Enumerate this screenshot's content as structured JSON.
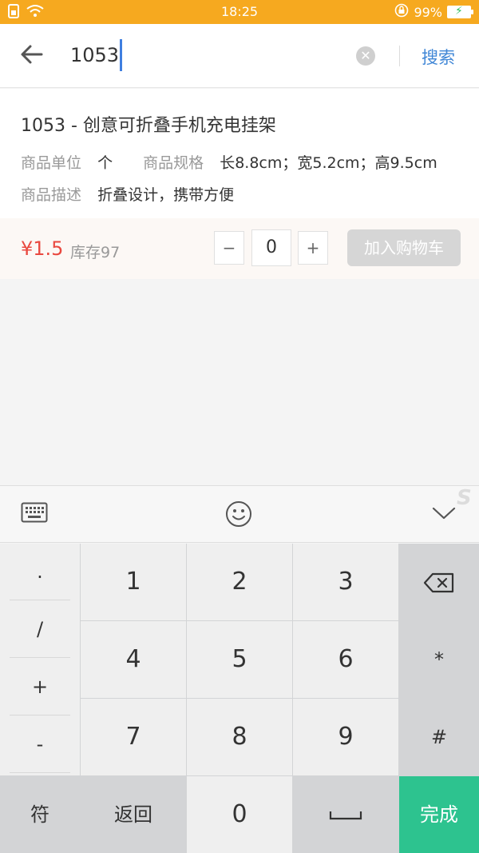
{
  "status_bar": {
    "time": "18:25",
    "battery": "99%"
  },
  "search": {
    "value": "1053",
    "button_label": "搜索"
  },
  "product": {
    "title": "1053 - 创意可折叠手机充电挂架",
    "unit_label": "商品单位",
    "unit_value": "个",
    "spec_label": "商品规格",
    "spec_value": "长8.8cm；宽5.2cm；高9.5cm",
    "desc_label": "商品描述",
    "desc_value": "折叠设计，携带方便",
    "price": "¥1.5",
    "stock": "库存97",
    "quantity": "0",
    "minus_label": "−",
    "plus_label": "+",
    "add_cart_label": "加入购物车"
  },
  "keyboard": {
    "side_keys": [
      ".",
      "/",
      "+",
      "-"
    ],
    "digits": [
      "1",
      "2",
      "3",
      "4",
      "5",
      "6",
      "7",
      "8",
      "9",
      "0"
    ],
    "star": "*",
    "hash": "#",
    "symbol_label": "符",
    "back_label": "返回",
    "done_label": "完成",
    "brand_mark": "S"
  },
  "colors": {
    "status_bar": "#f6a91f",
    "accent": "#3f86d6",
    "price": "#e9483f",
    "done": "#2dc38f"
  }
}
